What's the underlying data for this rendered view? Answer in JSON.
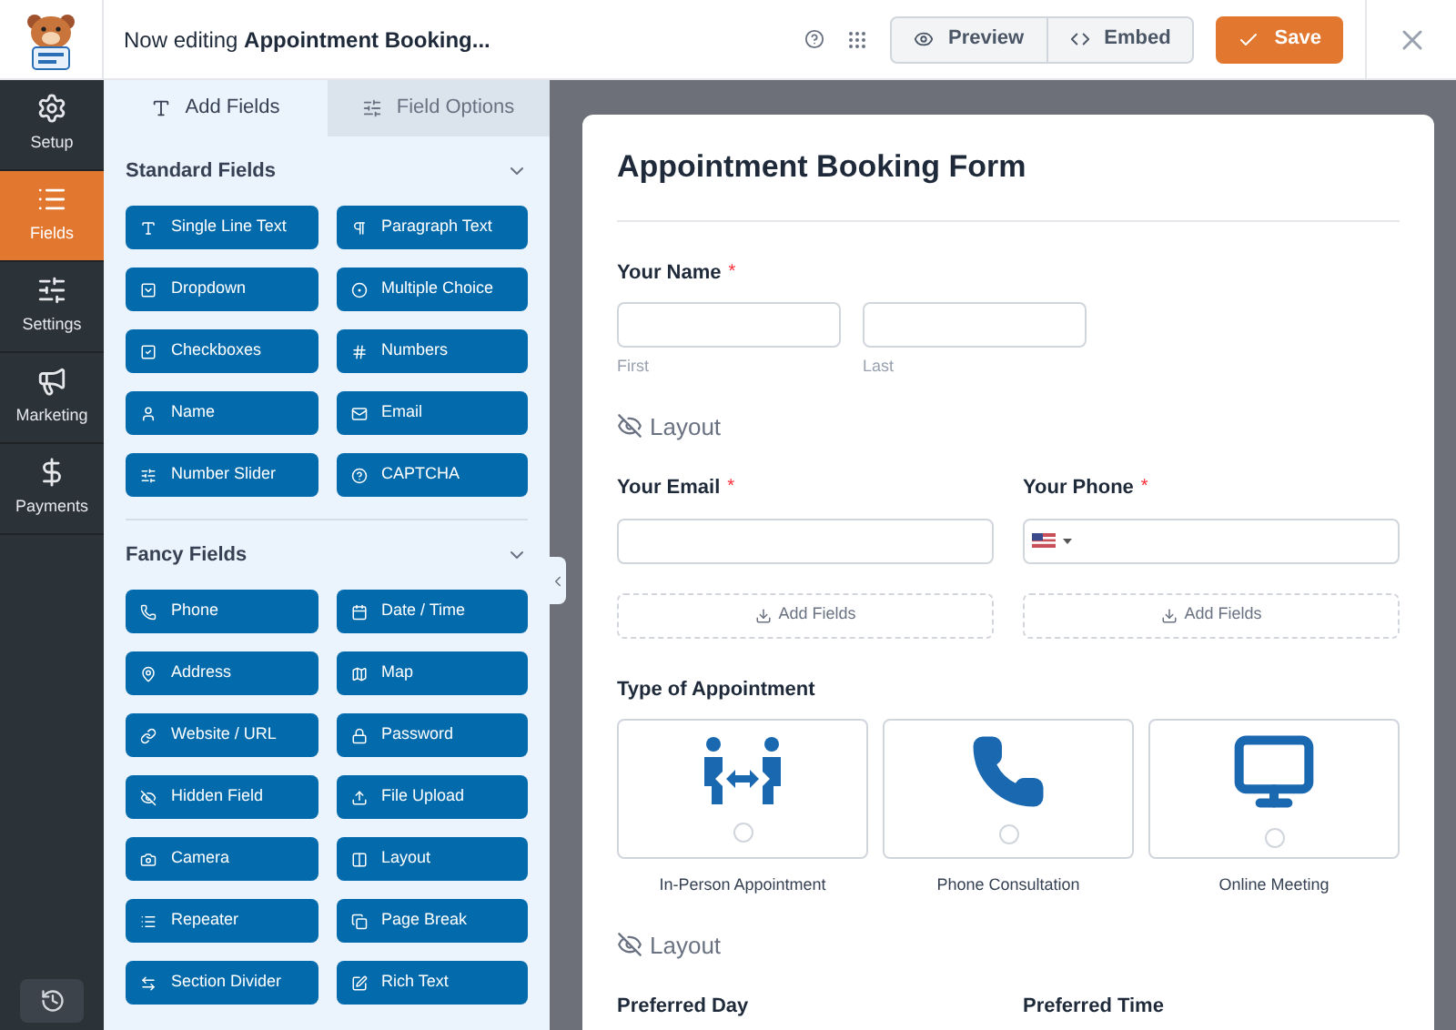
{
  "header": {
    "title": "Now editing **Appointment Booking...**",
    "preview": "Preview",
    "embed": "Embed",
    "save": "Save"
  },
  "nav": [
    {
      "label": "Setup",
      "selected": false
    },
    {
      "label": "Fields",
      "selected": true
    },
    {
      "label": "Settings",
      "selected": false
    },
    {
      "label": "Marketing",
      "selected": false
    },
    {
      "label": "Payments",
      "selected": false
    }
  ],
  "tabs": [
    {
      "label": "Add Fields",
      "selected": true
    },
    {
      "label": "Field Options",
      "selected": false
    }
  ],
  "groups": [
    {
      "title": "Standard Fields",
      "expanded": true,
      "fields": [
        "Single Line Text",
        "Paragraph Text",
        "Dropdown",
        "Multiple Choice",
        "Checkboxes",
        "Numbers",
        "Name",
        "Email",
        "Number Slider",
        "CAPTCHA"
      ]
    },
    {
      "title": "Fancy Fields",
      "expanded": true,
      "fields": [
        "Phone",
        "Date / Time",
        "Address",
        "Map",
        "Website / URL",
        "Password",
        "Hidden Field",
        "File Upload",
        "Camera",
        "Layout",
        "Repeater",
        "Page Break",
        "Section Divider",
        "Rich Text"
      ]
    }
  ],
  "form": {
    "title": "Appointment Booking Form",
    "items": [
      {
        "kind": "name",
        "label": "Your Name",
        "required_mark": "*",
        "sublabels": [
          "First",
          "Last"
        ]
      },
      {
        "kind": "layout",
        "label": "Layout"
      },
      {
        "kind": "columns",
        "columns": [
          {
            "label": "Your Email",
            "required_mark": "*",
            "kind": "text"
          },
          {
            "label": "Your Phone",
            "required_mark": "*",
            "kind": "phone"
          }
        ]
      },
      {
        "kind": "dropzones",
        "labels": [
          "Add Fields",
          "Add Fields"
        ]
      },
      {
        "kind": "choices",
        "label": "Type of Appointment",
        "options": [
          {
            "label": "In-Person Appointment",
            "selected": false
          },
          {
            "label": "Phone Consultation",
            "selected": false
          },
          {
            "label": "Online Meeting",
            "selected": false
          }
        ]
      },
      {
        "kind": "layout",
        "label": "Layout"
      },
      {
        "kind": "columns",
        "columns": [
          {
            "label": "Preferred Day",
            "kind": "none"
          },
          {
            "label": "Preferred Time",
            "kind": "none"
          }
        ]
      }
    ]
  }
}
